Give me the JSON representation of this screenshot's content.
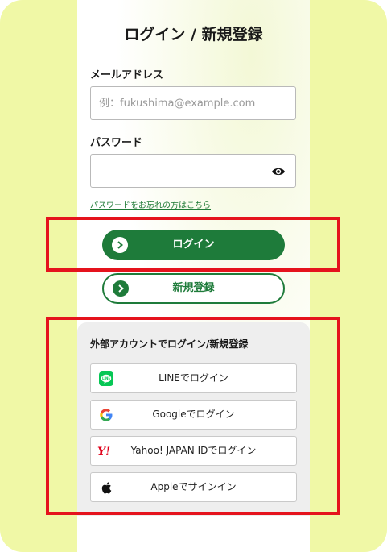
{
  "page": {
    "title": "ログイン / 新規登録"
  },
  "form": {
    "email_label": "メールアドレス",
    "email_placeholder": "例：fukushima@example.com",
    "email_value": "",
    "password_label": "パスワード",
    "password_value": "",
    "forgot_link": "パスワードをお忘れの方はこちら"
  },
  "buttons": {
    "login": "ログイン",
    "signup": "新規登録"
  },
  "external": {
    "title": "外部アカウントでログイン/新規登録",
    "items": [
      {
        "label": "LINEでログイン",
        "icon": "line-icon"
      },
      {
        "label": "Googleでログイン",
        "icon": "google-icon"
      },
      {
        "label": "Yahoo! JAPAN IDでログイン",
        "icon": "yahoo-icon"
      },
      {
        "label": "Appleでサインイン",
        "icon": "apple-icon"
      }
    ]
  },
  "colors": {
    "background": "#f0f8a6",
    "primary_green": "#1e7b3a",
    "highlight_red": "#e5131d"
  }
}
